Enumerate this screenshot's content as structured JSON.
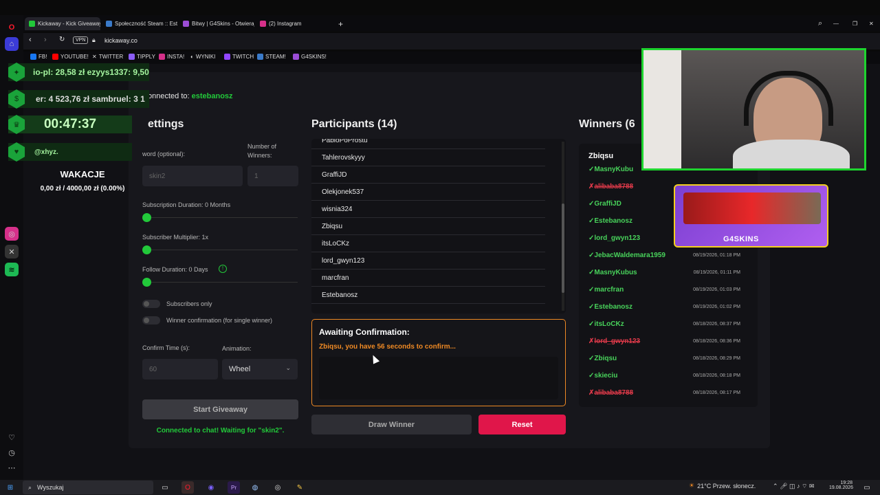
{
  "browser": {
    "tabs": [
      {
        "label": "Kickaway - Kick Giveaway",
        "color": "#22c93a"
      },
      {
        "label": "Społeczność Steam :: Este",
        "color": "#3a7ac9"
      },
      {
        "label": "Bitwy | G4Skins - Otwieraj",
        "color": "#9b4dd6"
      },
      {
        "label": "(2) Instagram",
        "color": "#d6308a"
      }
    ],
    "url": "kickaway.co",
    "vpn": "VPN",
    "bookmarks": [
      "FB!",
      "YOUTUBE!",
      "TWITTER",
      "TIPPLY",
      "INSTA!",
      "WYNIKI",
      "TWITCH",
      "STEAM!",
      "G4SKINS!"
    ]
  },
  "header": {
    "connected_label": "onnected to:",
    "connected_user": "estebanosz"
  },
  "settings": {
    "title": "ettings",
    "keyword_label": "word (optional):",
    "keyword_value": "skin2",
    "winners_label": "Number of Winners:",
    "winners_value": "1",
    "sub_duration_label": "Subscription Duration: 0 Months",
    "sub_multiplier_label": "Subscriber Multiplier: 1x",
    "follow_duration_label": "Follow Duration:  0  Days",
    "subscribers_only_label": "Subscribers only",
    "winner_confirm_label": "Winner confirmation (for single winner)",
    "confirm_time_label": "Confirm Time (s):",
    "confirm_time_value": "60",
    "animation_label": "Animation:",
    "animation_value": "Wheel",
    "start_button": "Start Giveaway",
    "status": "Connected to chat! Waiting for \"skin2\"."
  },
  "participants": {
    "title": "Participants (14)",
    "items": [
      "PabloPoProstu",
      "Tahlerovskyyy",
      "GraffiJD",
      "Olekjonek537",
      "wisnia324",
      "Zbiqsu",
      "itsLoCKz",
      "lord_gwyn123",
      "marcfran",
      "Estebanosz"
    ]
  },
  "confirmation": {
    "title": "Awaiting Confirmation:",
    "message": "Zbiqsu, you have 56 seconds to confirm..."
  },
  "actions": {
    "draw": "Draw Winner",
    "reset": "Reset"
  },
  "winners": {
    "title": "Winners (6",
    "current": "Zbiqsu",
    "items": [
      {
        "name": "MasnyKubu",
        "status": "ok",
        "date": ""
      },
      {
        "name": "alibaba8788",
        "status": "bad",
        "date": ""
      },
      {
        "name": "GraffiJD",
        "status": "ok",
        "date": ""
      },
      {
        "name": "Estebanosz",
        "status": "ok",
        "date": ""
      },
      {
        "name": "lord_gwyn123",
        "status": "ok",
        "date": ""
      },
      {
        "name": "JebacWaldemara1959",
        "status": "ok",
        "date": "08/19/2026, 01:18 PM"
      },
      {
        "name": "MasnyKubus",
        "status": "ok",
        "date": "08/19/2026, 01:11 PM"
      },
      {
        "name": "marcfran",
        "status": "ok",
        "date": "08/19/2026, 01:03 PM"
      },
      {
        "name": "Estebanosz",
        "status": "ok",
        "date": "08/19/2026, 01:02 PM"
      },
      {
        "name": "itsLoCKz",
        "status": "ok",
        "date": "08/18/2026, 08:37 PM"
      },
      {
        "name": "lord_gwyn123",
        "status": "bad",
        "date": "08/18/2026, 08:36 PM"
      },
      {
        "name": "Zbiqsu",
        "status": "ok",
        "date": "08/18/2026, 08:29 PM"
      },
      {
        "name": "skieciu",
        "status": "ok",
        "date": "08/18/2026, 08:18 PM"
      },
      {
        "name": "alibaba8788",
        "status": "bad",
        "date": "08/18/2026, 08:17 PM"
      }
    ]
  },
  "overlay": {
    "row1": "io-pl: 28,58 zł ezyys1337: 9,50",
    "row2": "er: 4 523,76 zł sambruel: 3 1",
    "timer": "00:47:37",
    "row4": "@xhyz.",
    "goal_title": "WAKACJE",
    "goal_value": "0,00 zł / 4000,00 zł (0.00%)",
    "sponsor": "G4SKINS"
  },
  "taskbar": {
    "search": "Wyszukaj",
    "weather": "21°C  Przew. słonecz.",
    "time": "19:28",
    "date": "19.08.2026"
  },
  "colors": {
    "green": "#22c93a",
    "red": "#e0164a",
    "orange": "#f08a24"
  }
}
